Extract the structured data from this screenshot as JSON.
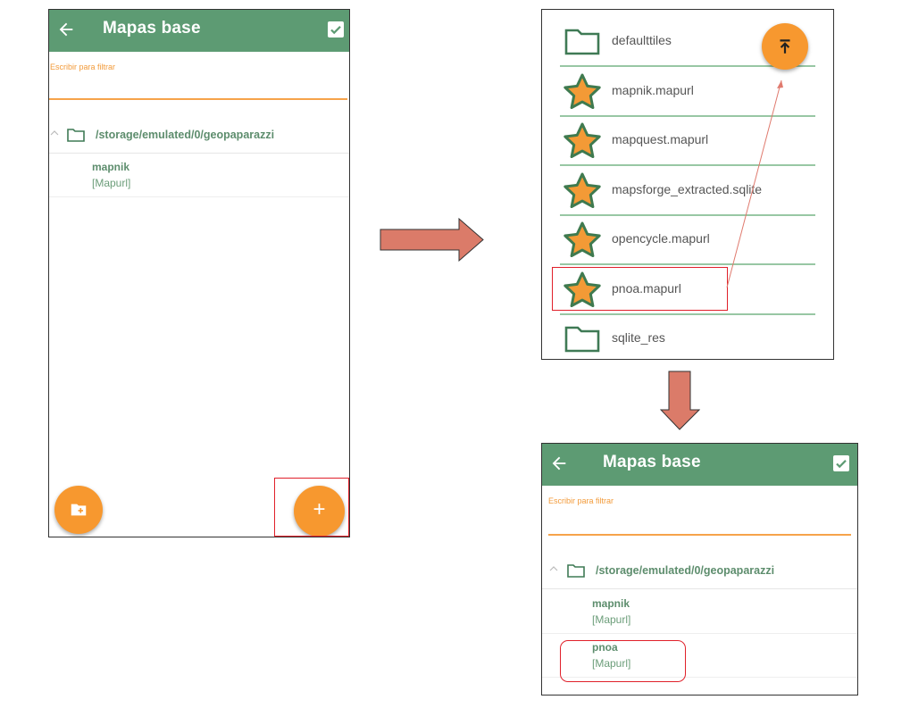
{
  "left_screen": {
    "appbar": {
      "title": "Mapas base"
    },
    "filter": {
      "hint": "Escribir para filtrar"
    },
    "folder": {
      "path": "/storage/emulated/0/geopaparazzi"
    },
    "entries": [
      {
        "name": "mapnik",
        "type": "[Mapurl]"
      }
    ],
    "fab_add": {
      "label": "+"
    }
  },
  "file_browser": {
    "items": [
      {
        "name": "defaulttiles",
        "icon": "folder-icon"
      },
      {
        "name": "mapnik.mapurl",
        "icon": "star-icon"
      },
      {
        "name": "mapquest.mapurl",
        "icon": "star-icon"
      },
      {
        "name": "mapsforge_extracted.sqlite",
        "icon": "star-icon"
      },
      {
        "name": "opencycle.mapurl",
        "icon": "star-icon"
      },
      {
        "name": "pnoa.mapurl",
        "icon": "star-icon"
      },
      {
        "name": "sqlite_res",
        "icon": "folder-icon"
      }
    ]
  },
  "right_screen": {
    "appbar": {
      "title": "Mapas base"
    },
    "filter": {
      "hint": "Escribir para filtrar"
    },
    "folder": {
      "path": "/storage/emulated/0/geopaparazzi"
    },
    "entries": [
      {
        "name": "mapnik",
        "type": "[Mapurl]"
      },
      {
        "name": "pnoa",
        "type": "[Mapurl]"
      }
    ]
  },
  "colors": {
    "appbar": "#5d9b73",
    "accent": "#f7982f",
    "arrow": "#db7b69",
    "highlight": "#e0202a"
  }
}
